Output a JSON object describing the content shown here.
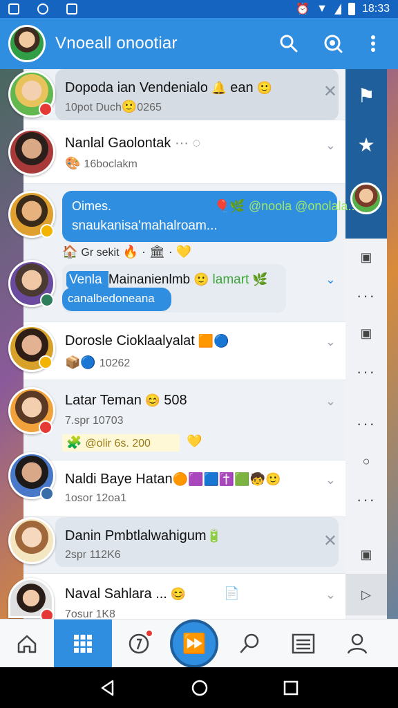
{
  "status_bar": {
    "time": "18:33"
  },
  "app_bar": {
    "title": "Vnoeall onootiar"
  },
  "chats": [
    {
      "name": "Dopoda ian Vendenialo",
      "name_tail": "ean",
      "sub": "10pot Duch",
      "sub_tail": "0265"
    },
    {
      "name": "Nanlal Gaolontak",
      "sub": "16boclakm"
    },
    {
      "bubble_title": "Oimes.",
      "bubble_tags": "@noola @onolala..",
      "bubble_body": "snaukanisa'mahalroam...",
      "meta": "Gr sekit"
    },
    {
      "name": "Venla ",
      "name_bold": "Mainanienlmb",
      "name_green": "lamart",
      "bubble_line2": "canalbedoneana"
    },
    {
      "name": "Dorosle Cioklaalyalat",
      "sub": "10262"
    },
    {
      "name": "Latar Teman",
      "name_tail": "508",
      "sub": "7.spr 10703",
      "tag": "@olir 6s. 200"
    },
    {
      "name": "Naldi Baye Hatan",
      "sub": "1osor 12oa1"
    },
    {
      "name": "Danin Pmbtlalwahigum",
      "sub": "2spr 112K6"
    },
    {
      "name": "Naval Sahlara",
      "name_tail": "...",
      "sub": "7osur 1K8"
    }
  ],
  "icons": {
    "search": "search-icon",
    "refresh_search": "zoom-icon",
    "more": "more-vert-icon",
    "flag": "flag-icon",
    "star": "star-icon",
    "home": "home-icon",
    "grid": "grid-icon",
    "chat": "chat-icon",
    "compose": "compose-icon",
    "search_nav": "search-nav-icon",
    "list": "list-icon",
    "profile": "profile-icon"
  },
  "colors": {
    "primary": "#2f8ee0",
    "dark": "#1f5f9c",
    "badge_red": "#e53935"
  }
}
